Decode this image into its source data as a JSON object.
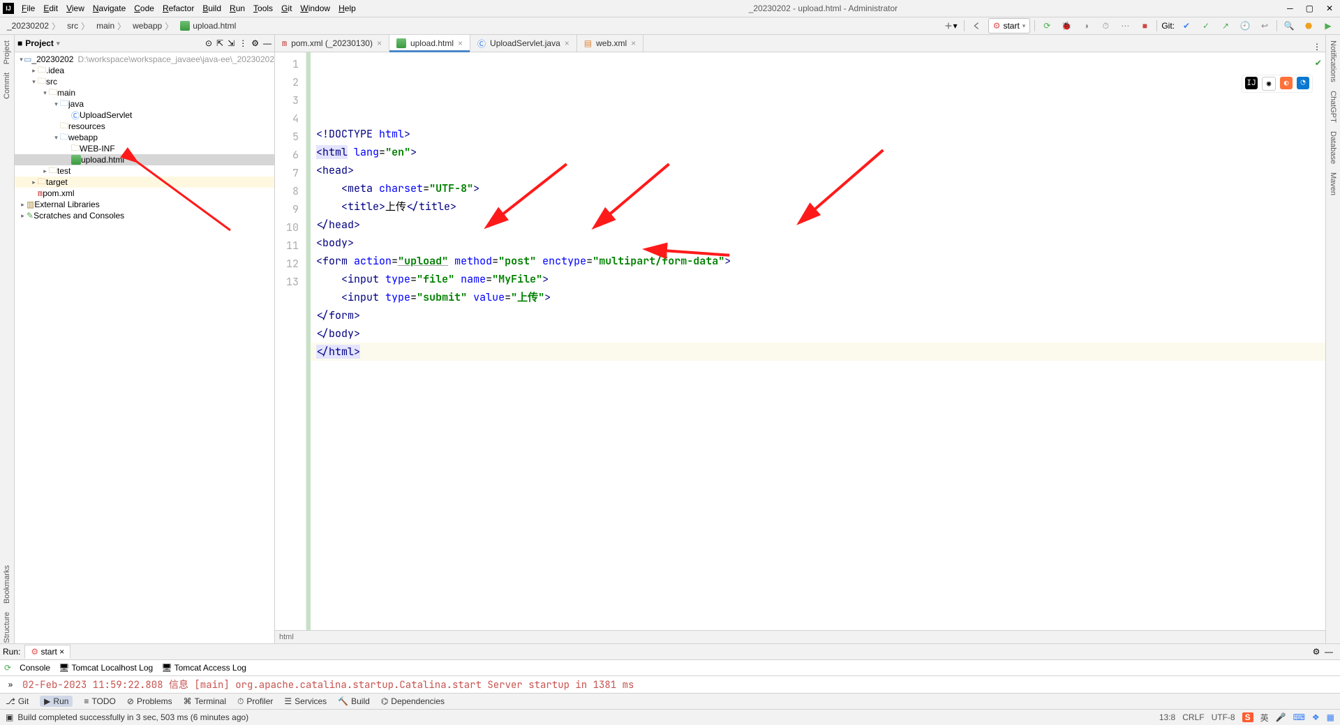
{
  "window": {
    "title": "_20230202 - upload.html - Administrator",
    "logo": "IJ"
  },
  "menu": [
    "File",
    "Edit",
    "View",
    "Navigate",
    "Code",
    "Refactor",
    "Build",
    "Run",
    "Tools",
    "Git",
    "Window",
    "Help"
  ],
  "breadcrumbs": {
    "items": [
      "_20230202",
      "src",
      "main",
      "webapp",
      "upload.html"
    ]
  },
  "toolbar": {
    "run_config": "start",
    "git_label": "Git:"
  },
  "left_stripe": [
    "Project",
    "Commit"
  ],
  "right_stripe": [
    "Notifications",
    "ChatGPT",
    "Database",
    "Maven"
  ],
  "project": {
    "title": "Project",
    "root": {
      "name": "_20230202",
      "path": "D:\\workspace\\workspace_javaee\\java-ee\\_20230202"
    },
    "tree": [
      {
        "indent": 0,
        "arrow": "v",
        "icon": "module",
        "label": "_20230202",
        "suffix": "D:\\workspace\\workspace_javaee\\java-ee\\_20230202"
      },
      {
        "indent": 1,
        "arrow": ">",
        "icon": "folder",
        "label": ".idea"
      },
      {
        "indent": 1,
        "arrow": "v",
        "icon": "folder",
        "label": "src"
      },
      {
        "indent": 2,
        "arrow": "v",
        "icon": "folder",
        "label": "main"
      },
      {
        "indent": 3,
        "arrow": "v",
        "icon": "bluefolder",
        "label": "java"
      },
      {
        "indent": 4,
        "arrow": "",
        "icon": "class",
        "label": "UploadServlet"
      },
      {
        "indent": 3,
        "arrow": "",
        "icon": "resfolder",
        "label": "resources"
      },
      {
        "indent": 3,
        "arrow": "v",
        "icon": "webfolder",
        "label": "webapp"
      },
      {
        "indent": 4,
        "arrow": "",
        "icon": "folder",
        "label": "WEB-INF"
      },
      {
        "indent": 4,
        "arrow": "",
        "icon": "html",
        "label": "upload.html",
        "selected": true
      },
      {
        "indent": 2,
        "arrow": ">",
        "icon": "folder",
        "label": "test"
      },
      {
        "indent": 1,
        "arrow": ">",
        "icon": "target",
        "label": "target",
        "target": true
      },
      {
        "indent": 1,
        "arrow": "",
        "icon": "maven",
        "label": "pom.xml"
      },
      {
        "indent": 0,
        "arrow": ">",
        "icon": "lib",
        "label": "External Libraries"
      },
      {
        "indent": 0,
        "arrow": ">",
        "icon": "scratch",
        "label": "Scratches and Consoles"
      }
    ]
  },
  "editor": {
    "tabs": [
      {
        "label": "pom.xml (_20230130)",
        "icon": "maven",
        "active": false
      },
      {
        "label": "upload.html",
        "icon": "html",
        "active": true
      },
      {
        "label": "UploadServlet.java",
        "icon": "class",
        "active": false
      },
      {
        "label": "web.xml",
        "icon": "xml",
        "active": false
      }
    ],
    "crumbtrail": "html",
    "caret": "13:8",
    "lines": 13,
    "code": {
      "l1": {
        "raw": "<!DOCTYPE html>"
      },
      "l2": {
        "tag_open": "html",
        "attrs": [
          [
            "lang",
            "en"
          ]
        ]
      },
      "l3": {
        "tag_open": "head"
      },
      "l4": {
        "indent": "    ",
        "tag_self": "meta",
        "attrs": [
          [
            "charset",
            "UTF-8"
          ]
        ]
      },
      "l5": {
        "indent": "    ",
        "tag_open": "title",
        "text": "上传",
        "tag_close": "title"
      },
      "l6": {
        "tag_close": "head"
      },
      "l7": {
        "tag_open": "body"
      },
      "l8": {
        "tag_open": "form",
        "attrs": [
          [
            "action",
            "upload"
          ],
          [
            "method",
            "post"
          ],
          [
            "enctype",
            "multipart/form-data"
          ]
        ],
        "underline_value": "upload"
      },
      "l9": {
        "indent": "    ",
        "tag_self": "input",
        "attrs": [
          [
            "type",
            "file"
          ],
          [
            "name",
            "MyFile"
          ]
        ]
      },
      "l10": {
        "indent": "    ",
        "tag_self": "input",
        "attrs": [
          [
            "type",
            "submit"
          ],
          [
            "value",
            "上传"
          ]
        ]
      },
      "l11": {
        "tag_close": "form"
      },
      "l12": {
        "tag_close": "body"
      },
      "l13": {
        "tag_close": "html",
        "caret": true
      }
    }
  },
  "run": {
    "label": "Run:",
    "config": "start",
    "subtabs": [
      "Console",
      "Tomcat Localhost Log",
      "Tomcat Access Log"
    ],
    "log_line": "02-Feb-2023 11:59:22.808 信息 [main] org.apache.catalina.startup.Catalina.start Server startup in 1381 ms"
  },
  "bottom_tools": [
    "Git",
    "Run",
    "TODO",
    "Problems",
    "Terminal",
    "Profiler",
    "Services",
    "Build",
    "Dependencies"
  ],
  "status": {
    "left_icon": "▣",
    "message": "Build completed successfully in 3 sec, 503 ms (6 minutes ago)",
    "right": [
      "13:8",
      "CRLF",
      "UTF-8"
    ]
  },
  "browsers": [
    "IJ",
    "Chrome",
    "Firefox",
    "Edge"
  ]
}
